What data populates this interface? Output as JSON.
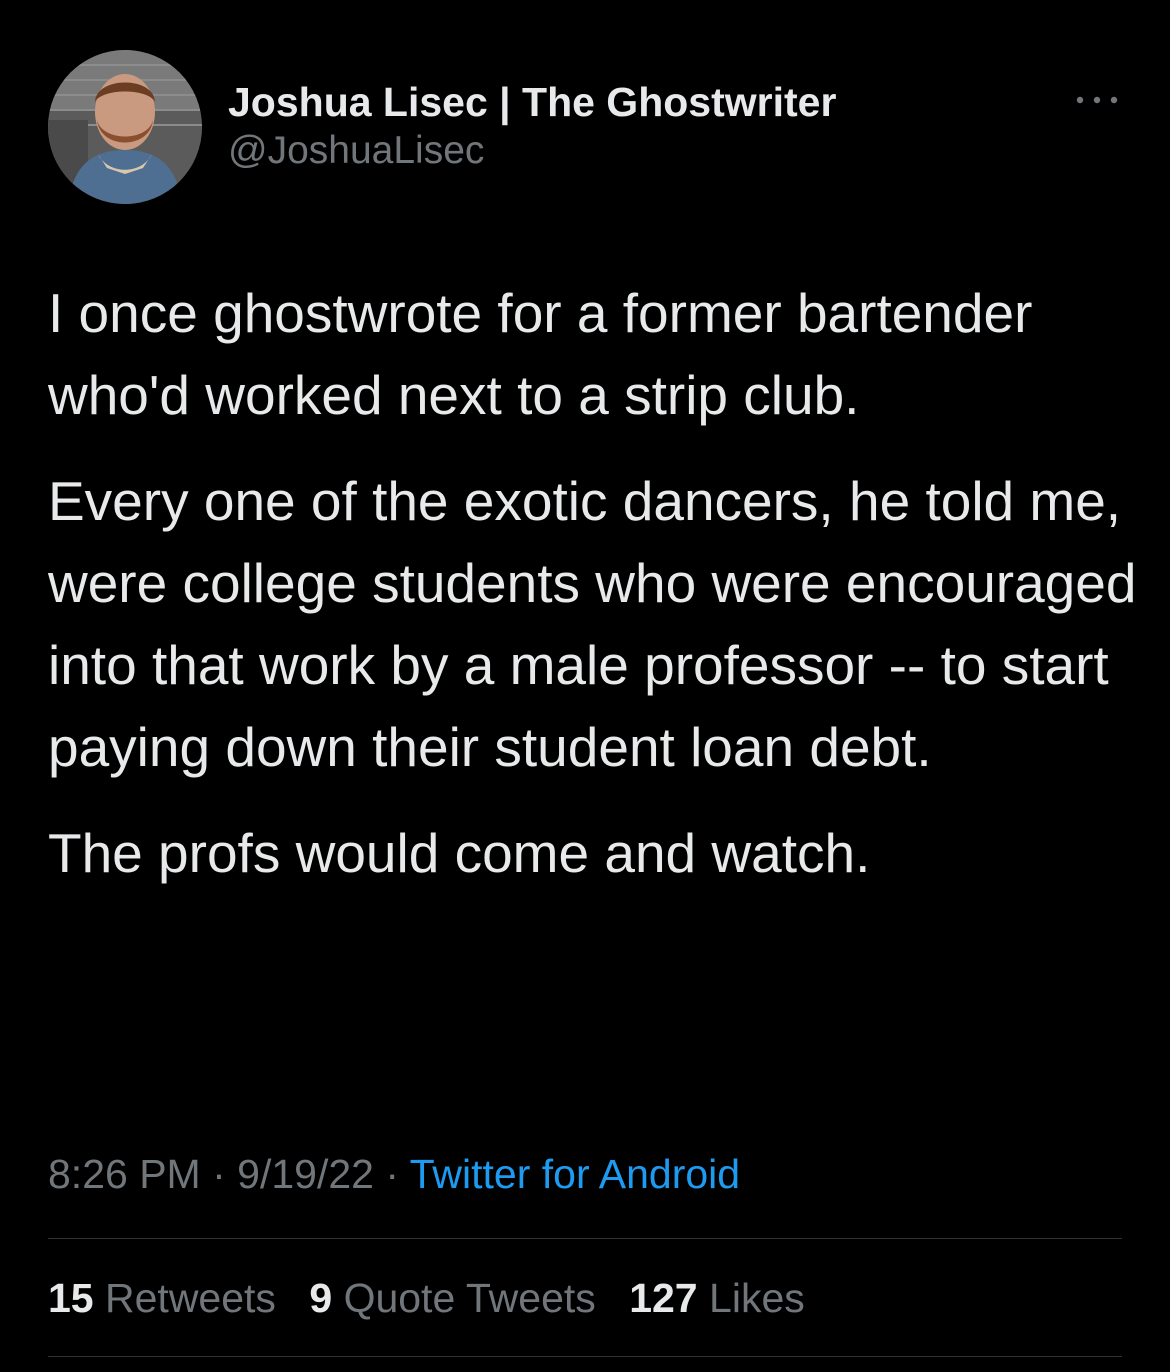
{
  "author": {
    "display_name": "Joshua Lisec | The Ghostwriter",
    "handle": "@JoshuaLisec",
    "avatar_icon": "person-photo-avatar"
  },
  "more_icon": "ellipsis-icon",
  "tweet": {
    "paragraphs": [
      "I once ghostwrote for a former bartender who'd worked next to a strip club.",
      "Every one of the exotic dancers, he told me, were college students who were encouraged into that work by a male professor -- to start paying down their student loan debt.",
      "The profs would come and watch."
    ]
  },
  "meta": {
    "time": "8:26 PM",
    "sep1": " · ",
    "date": "9/19/22",
    "sep2": " · ",
    "source": "Twitter for Android"
  },
  "stats": {
    "retweets_count": "15",
    "retweets_label": "Retweets",
    "quotes_count": "9",
    "quotes_label": "Quote Tweets",
    "likes_count": "127",
    "likes_label": "Likes"
  },
  "colors": {
    "background": "#000000",
    "primary_text": "#e7e9ea",
    "secondary_text": "#71767b",
    "link": "#1d9bf0",
    "divider": "#2f3336"
  }
}
